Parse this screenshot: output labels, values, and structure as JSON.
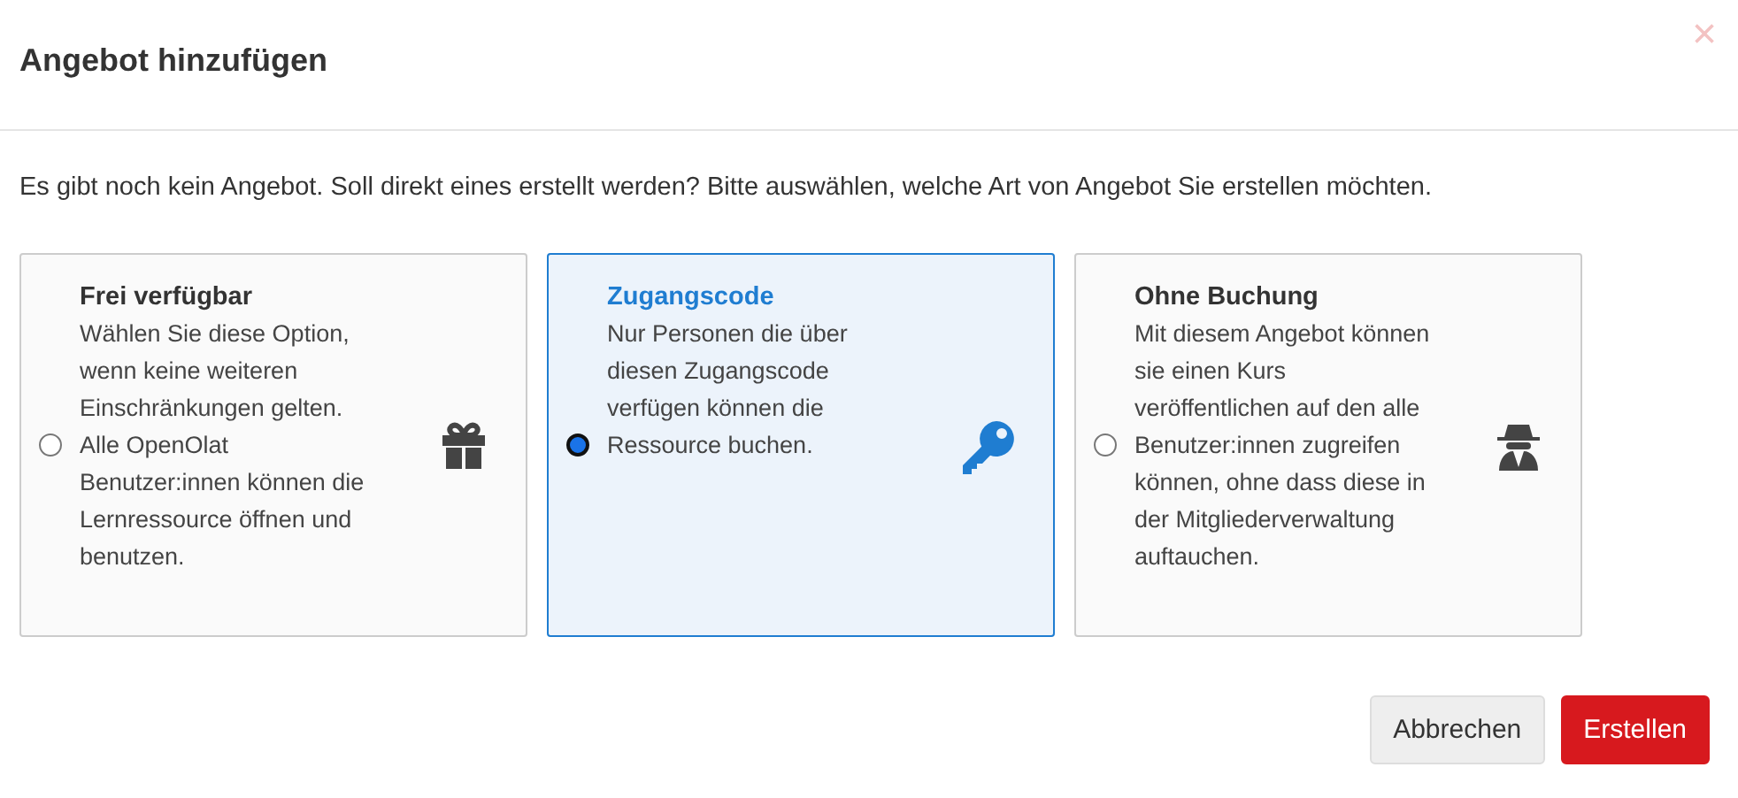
{
  "dialog": {
    "title": "Angebot hinzufügen",
    "close": "×"
  },
  "intro": "Es gibt noch kein Angebot. Soll direkt eines erstellt werden? Bitte auswählen, welche Art von Angebot Sie erstellen möchten.",
  "options": [
    {
      "kind": "gift",
      "title": "Frei verfügbar",
      "description": "Wählen Sie diese Option, wenn keine weiteren Einschränkungen gelten. Alle OpenOlat Benutzer:innen können die Lernressource öffnen und benutzen.",
      "selected": false
    },
    {
      "kind": "key",
      "title": "Zugangscode",
      "description": "Nur Personen die über diesen Zugangscode verfügen können die Ressource buchen.",
      "selected": true
    },
    {
      "kind": "spy",
      "title": "Ohne Buchung",
      "description": "Mit diesem Angebot können sie einen Kurs veröffentlichen auf den alle Benutzer:innen zugreifen können, ohne dass diese in der Mitgliederverwaltung auftauchen.",
      "selected": false
    }
  ],
  "buttons": [
    {
      "kind": "secondary",
      "label": "Abbrechen"
    },
    {
      "kind": "primary",
      "label": "Erstellen"
    }
  ]
}
